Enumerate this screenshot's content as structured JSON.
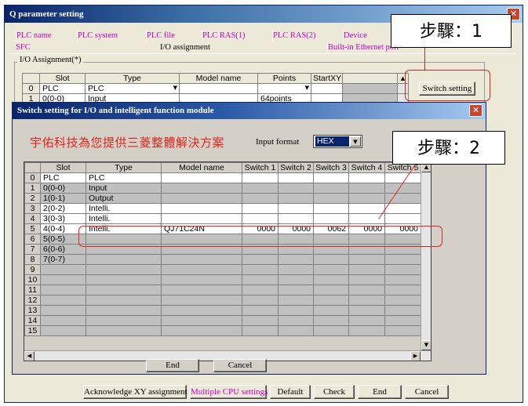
{
  "outer": {
    "title": "Q parameter setting",
    "tabs_row1": [
      "PLC name",
      "PLC system",
      "PLC file",
      "PLC RAS(1)",
      "PLC RAS(2)",
      "Device"
    ],
    "tabs_row2": [
      "SFC",
      "I/O assignment",
      "Built-in Ethernet port"
    ],
    "group_label": "I/O Assignment(*)",
    "grid_headers": [
      "Slot",
      "Type",
      "Model name",
      "Points",
      "StartXY"
    ],
    "grid_rows": [
      {
        "no": "0",
        "slot": "PLC",
        "type": "PLC",
        "model": "",
        "points": "",
        "start": ""
      },
      {
        "no": "1",
        "slot": "0(0-0)",
        "type": "Input",
        "model": "",
        "points": "64points",
        "start": ""
      }
    ],
    "switch_setting_label": "Switch setting",
    "bottom_buttons": [
      "Acknowledge XY assignment",
      "Multiple CPU settings",
      "Default",
      "Check",
      "End",
      "Cancel"
    ]
  },
  "annotations": {
    "step1": "步驟：1",
    "step2": "步驟：2"
  },
  "dialog": {
    "title": "Switch setting for I/O and intelligent function module",
    "company_text": "宇佑科技為您提供三菱整體解決方案",
    "input_format_label": "Input format",
    "input_format_value": "HEX",
    "headers": [
      "Slot",
      "Type",
      "Model name",
      "Switch 1",
      "Switch 2",
      "Switch 3",
      "Switch 4",
      "Switch 5"
    ],
    "rows": [
      {
        "no": "0",
        "slot": "PLC",
        "type": "PLC",
        "model": "",
        "sw": [
          "",
          "",
          "",
          "",
          ""
        ]
      },
      {
        "no": "1",
        "slot": "0(0-0)",
        "type": "Input",
        "model": "",
        "sw": [
          "",
          "",
          "",
          "",
          ""
        ]
      },
      {
        "no": "2",
        "slot": "1(0-1)",
        "type": "Output",
        "model": "",
        "sw": [
          "",
          "",
          "",
          "",
          ""
        ]
      },
      {
        "no": "3",
        "slot": "2(0-2)",
        "type": "Intelli.",
        "model": "",
        "sw": [
          "",
          "",
          "",
          "",
          ""
        ]
      },
      {
        "no": "4",
        "slot": "3(0-3)",
        "type": "Intelli.",
        "model": "",
        "sw": [
          "",
          "",
          "",
          "",
          ""
        ]
      },
      {
        "no": "5",
        "slot": "4(0-4)",
        "type": "Intelli.",
        "model": "QJ71C24N",
        "sw": [
          "0000",
          "0000",
          "0062",
          "0000",
          "0000"
        ]
      },
      {
        "no": "6",
        "slot": "5(0-5)",
        "type": "",
        "model": "",
        "sw": [
          "",
          "",
          "",
          "",
          ""
        ]
      },
      {
        "no": "7",
        "slot": "6(0-6)",
        "type": "",
        "model": "",
        "sw": [
          "",
          "",
          "",
          "",
          ""
        ]
      },
      {
        "no": "8",
        "slot": "7(0-7)",
        "type": "",
        "model": "",
        "sw": [
          "",
          "",
          "",
          "",
          ""
        ]
      },
      {
        "no": "9",
        "slot": "",
        "type": "",
        "model": "",
        "sw": [
          "",
          "",
          "",
          "",
          ""
        ]
      },
      {
        "no": "10",
        "slot": "",
        "type": "",
        "model": "",
        "sw": [
          "",
          "",
          "",
          "",
          ""
        ]
      },
      {
        "no": "11",
        "slot": "",
        "type": "",
        "model": "",
        "sw": [
          "",
          "",
          "",
          "",
          ""
        ]
      },
      {
        "no": "12",
        "slot": "",
        "type": "",
        "model": "",
        "sw": [
          "",
          "",
          "",
          "",
          ""
        ]
      },
      {
        "no": "13",
        "slot": "",
        "type": "",
        "model": "",
        "sw": [
          "",
          "",
          "",
          "",
          ""
        ]
      },
      {
        "no": "14",
        "slot": "",
        "type": "",
        "model": "",
        "sw": [
          "",
          "",
          "",
          "",
          ""
        ]
      },
      {
        "no": "15",
        "slot": "",
        "type": "",
        "model": "",
        "sw": [
          "",
          "",
          "",
          "",
          ""
        ]
      }
    ],
    "end_label": "End",
    "cancel_label": "Cancel"
  },
  "colors": {
    "titlebar": "#0a246a",
    "close_button": "#c7442e",
    "annotation_red": "#e0261c",
    "tab_magenta": "#cc00cc"
  }
}
